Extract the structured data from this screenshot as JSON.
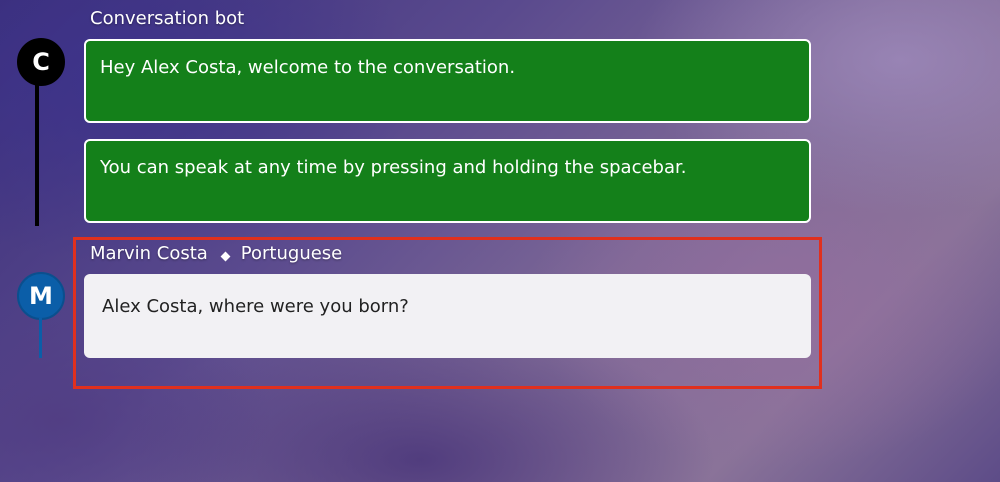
{
  "bot": {
    "name": "Conversation bot",
    "avatar_letter": "C",
    "messages": [
      "Hey Alex Costa, welcome to the conversation.",
      "You can speak at any time by pressing and holding the spacebar."
    ]
  },
  "user": {
    "name": "Marvin Costa",
    "language": "Portuguese",
    "avatar_letter": "M",
    "message": "Alex Costa, where were you born?"
  },
  "colors": {
    "bot_bubble": "#14801a",
    "bot_avatar": "#000000",
    "user_avatar": "#0b5ea8",
    "user_bubble": "#f2f1f4",
    "highlight": "#e0301e"
  },
  "icons": {
    "separator": "diamond-icon"
  }
}
